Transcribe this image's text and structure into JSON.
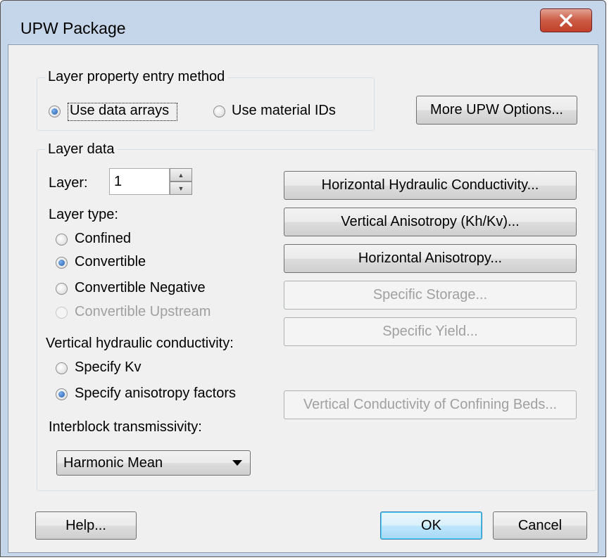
{
  "window": {
    "title": "UPW Package",
    "close_label": "x"
  },
  "layer_entry": {
    "group_label": "Layer property entry method",
    "options": [
      {
        "label": "Use data arrays",
        "checked": true
      },
      {
        "label": "Use material IDs",
        "checked": false
      }
    ],
    "more_options_label": "More UPW Options..."
  },
  "layer_data": {
    "group_label": "Layer data",
    "layer_label": "Layer:",
    "layer_value": "1",
    "layer_type_label": "Layer type:",
    "layer_types": [
      {
        "label": "Confined",
        "checked": false,
        "enabled": true
      },
      {
        "label": "Convertible",
        "checked": true,
        "enabled": true
      },
      {
        "label": "Convertible Negative",
        "checked": false,
        "enabled": true
      },
      {
        "label": "Convertible Upstream",
        "checked": false,
        "enabled": false
      }
    ],
    "vk_label": "Vertical hydraulic conductivity:",
    "vk_options": [
      {
        "label": "Specify Kv",
        "checked": false
      },
      {
        "label": "Specify anisotropy factors",
        "checked": true
      }
    ],
    "interblock_label": "Interblock transmissivity:",
    "interblock_value": "Harmonic Mean",
    "buttons": [
      {
        "label": "Horizontal Hydraulic Conductivity...",
        "enabled": true
      },
      {
        "label": "Vertical Anisotropy (Kh/Kv)...",
        "enabled": true
      },
      {
        "label": "Horizontal Anisotropy...",
        "enabled": true
      },
      {
        "label": "Specific Storage...",
        "enabled": false
      },
      {
        "label": "Specific Yield...",
        "enabled": false
      },
      {
        "label": "Vertical Conductivity of Confining Beds...",
        "enabled": false
      }
    ]
  },
  "footer": {
    "help_label": "Help...",
    "ok_label": "OK",
    "cancel_label": "Cancel"
  }
}
